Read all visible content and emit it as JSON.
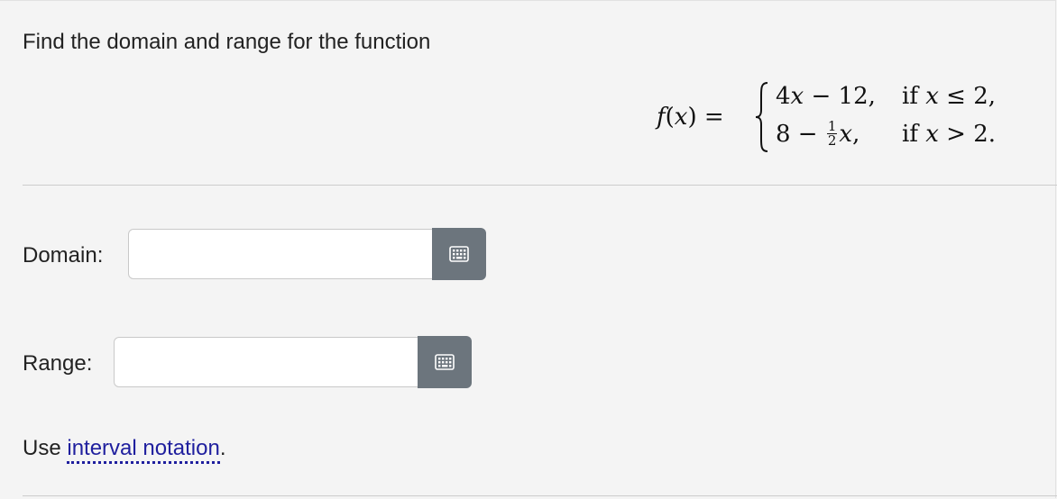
{
  "question": {
    "prompt": "Find the domain and range for the function"
  },
  "formula": {
    "lhs_func": "f",
    "lhs_open": "(",
    "lhs_var": "x",
    "lhs_close": ") =",
    "case1_expr_a": "4",
    "case1_expr_var": "x",
    "case1_expr_b": " − 12,",
    "case1_cond_if": "if ",
    "case1_cond_var": "x",
    "case1_cond_rest": " ≤ 2,",
    "case2_expr_a": "8 − ",
    "case2_frac_num": "1",
    "case2_frac_den": "2",
    "case2_expr_var": "x",
    "case2_expr_b": ",",
    "case2_cond_if": "if ",
    "case2_cond_var": "x",
    "case2_cond_rest": " > 2."
  },
  "domain": {
    "label": "Domain:",
    "value": ""
  },
  "range": {
    "label": "Range:",
    "value": ""
  },
  "footer": {
    "prefix": "Use ",
    "link": "interval notation",
    "suffix": "."
  },
  "icons": {
    "keyboard": "keyboard-icon"
  },
  "colors": {
    "background": "#f4f4f4",
    "button": "#6c757d",
    "link": "#1f1f9e"
  }
}
